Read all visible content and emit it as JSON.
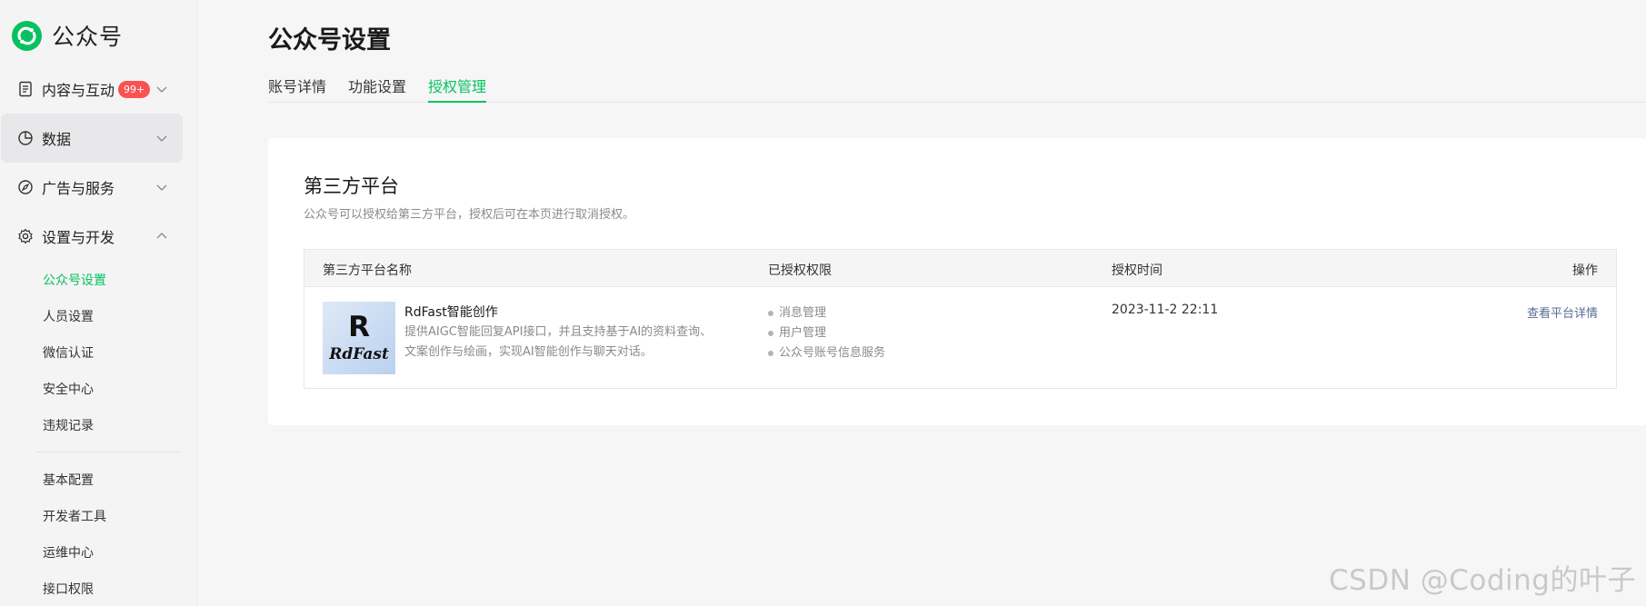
{
  "brand": {
    "name": "公众号"
  },
  "sidebar": {
    "items": [
      {
        "label": "内容与互动",
        "badge": "99+",
        "icon": "document-icon",
        "expanded": false
      },
      {
        "label": "数据",
        "icon": "pie-chart-icon",
        "expanded": false
      },
      {
        "label": "广告与服务",
        "icon": "compass-icon",
        "expanded": false
      },
      {
        "label": "设置与开发",
        "icon": "gear-icon",
        "expanded": true
      }
    ],
    "sub_items": [
      "公众号设置",
      "人员设置",
      "微信认证",
      "安全中心",
      "违规记录"
    ],
    "dev_items": [
      "基本配置",
      "开发者工具",
      "运维中心",
      "接口权限"
    ]
  },
  "page": {
    "title": "公众号设置"
  },
  "tabs": [
    "账号详情",
    "功能设置",
    "授权管理"
  ],
  "active_tab": "授权管理",
  "section": {
    "title": "第三方平台",
    "desc": "公众号可以授权给第三方平台，授权后可在本页进行取消授权。"
  },
  "table": {
    "headers": [
      "第三方平台名称",
      "已授权权限",
      "授权时间",
      "操作"
    ],
    "rows": [
      {
        "logo_letter": "R",
        "logo_word": "RdFast",
        "name": "RdFast智能创作",
        "desc": "提供AIGC智能回复API接口，并且支持基于AI的资料查询、文案创作与绘画，实现AI智能创作与聊天对话。",
        "perms": [
          "消息管理",
          "用户管理",
          "公众号账号信息服务"
        ],
        "time": "2023-11-2 22:11",
        "action": "查看平台详情"
      }
    ]
  },
  "watermark": "CSDN @Coding的叶子",
  "colors": {
    "accent": "#07c160",
    "badge": "#fa5151",
    "link": "#576b95"
  }
}
